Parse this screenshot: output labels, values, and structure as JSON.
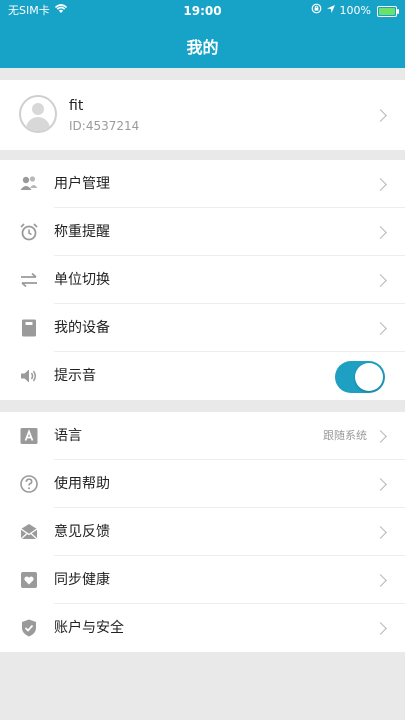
{
  "status_bar": {
    "carrier": "无SIM卡",
    "time": "19:00",
    "battery": "100%",
    "battery_level_percent": 100
  },
  "header": {
    "title": "我的"
  },
  "profile": {
    "name": "fit",
    "id": "ID:4537214"
  },
  "group1": {
    "items": [
      {
        "label": "用户管理",
        "icon": "users-icon"
      },
      {
        "label": "称重提醒",
        "icon": "alarm-clock-icon"
      },
      {
        "label": "单位切换",
        "icon": "swap-arrows-icon"
      },
      {
        "label": "我的设备",
        "icon": "device-icon"
      },
      {
        "label": "提示音",
        "icon": "speaker-icon",
        "toggle_on": true
      }
    ]
  },
  "group2": {
    "items": [
      {
        "label": "语言",
        "icon": "language-icon",
        "value": "跟随系统"
      },
      {
        "label": "使用帮助",
        "icon": "help-icon"
      },
      {
        "label": "意见反馈",
        "icon": "feedback-icon"
      },
      {
        "label": "同步健康",
        "icon": "health-icon"
      },
      {
        "label": "账户与安全",
        "icon": "shield-icon"
      }
    ]
  },
  "colors": {
    "accent": "#17a3c8",
    "background": "#e9e9e9",
    "icon_gray": "#9a9a9a"
  }
}
